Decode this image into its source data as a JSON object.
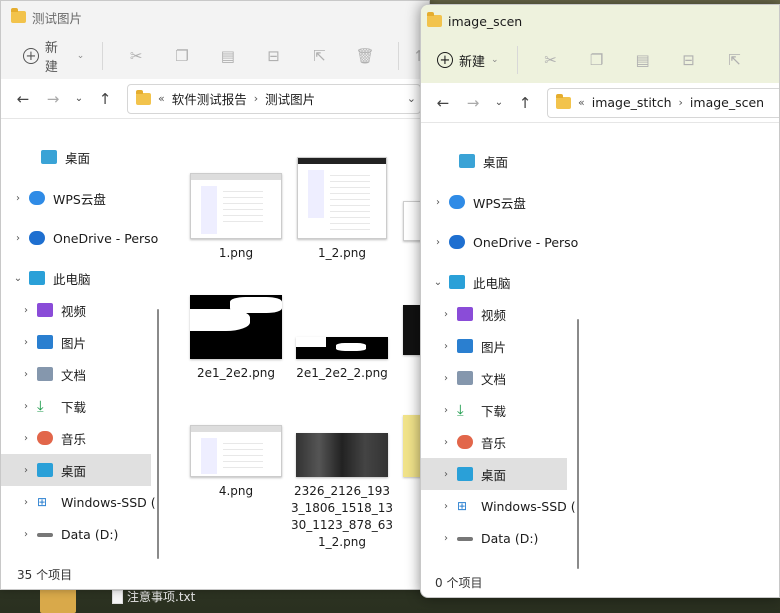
{
  "left_window": {
    "title": "测试图片",
    "toolbar": {
      "new_label": "新建"
    },
    "address": {
      "overflow": "«",
      "parts": [
        "软件测试报告",
        "测试图片"
      ]
    },
    "sidebar": [
      {
        "label": "桌面",
        "icon": "desktop-icon"
      },
      {
        "label": "WPS云盘",
        "icon": "cloud-icon"
      },
      {
        "label": "OneDrive - Perso",
        "icon": "onedrive-icon"
      },
      {
        "label": "此电脑",
        "icon": "computer-icon"
      },
      {
        "label": "视频",
        "icon": "video-icon"
      },
      {
        "label": "图片",
        "icon": "pictures-icon"
      },
      {
        "label": "文档",
        "icon": "document-icon"
      },
      {
        "label": "下载",
        "icon": "download-icon"
      },
      {
        "label": "音乐",
        "icon": "music-icon"
      },
      {
        "label": "桌面",
        "icon": "desktop-icon"
      },
      {
        "label": "Windows-SSD (",
        "icon": "drive-icon"
      },
      {
        "label": "Data (D:)",
        "icon": "drive-icon"
      }
    ],
    "files": [
      "1.png",
      "1_2.png",
      "2e1_2e2.png",
      "2e1_2e2_2.png",
      "4.png",
      "2326_2126_1933_1806_1518_1330_1123_878_631_2.png"
    ],
    "status": "35 个项目"
  },
  "right_window": {
    "title": "image_scen",
    "toolbar": {
      "new_label": "新建"
    },
    "address": {
      "overflow": "«",
      "parts": [
        "image_stitch",
        "image_scen"
      ]
    },
    "sidebar": [
      {
        "label": "桌面",
        "icon": "desktop-icon"
      },
      {
        "label": "WPS云盘",
        "icon": "cloud-icon"
      },
      {
        "label": "OneDrive - Perso",
        "icon": "onedrive-icon"
      },
      {
        "label": "此电脑",
        "icon": "computer-icon"
      },
      {
        "label": "视频",
        "icon": "video-icon"
      },
      {
        "label": "图片",
        "icon": "pictures-icon"
      },
      {
        "label": "文档",
        "icon": "document-icon"
      },
      {
        "label": "下载",
        "icon": "download-icon"
      },
      {
        "label": "音乐",
        "icon": "music-icon"
      },
      {
        "label": "桌面",
        "icon": "desktop-icon"
      },
      {
        "label": "Windows-SSD (",
        "icon": "drive-icon"
      },
      {
        "label": "Data (D:)",
        "icon": "drive-icon"
      }
    ],
    "status": "0 个项目"
  },
  "taskbar": {
    "file_label": "注意事项.txt"
  },
  "colors": {
    "folder": "#f2c34c",
    "right_title_bg": "#eef2dd",
    "selection": "#e0e0e0"
  }
}
